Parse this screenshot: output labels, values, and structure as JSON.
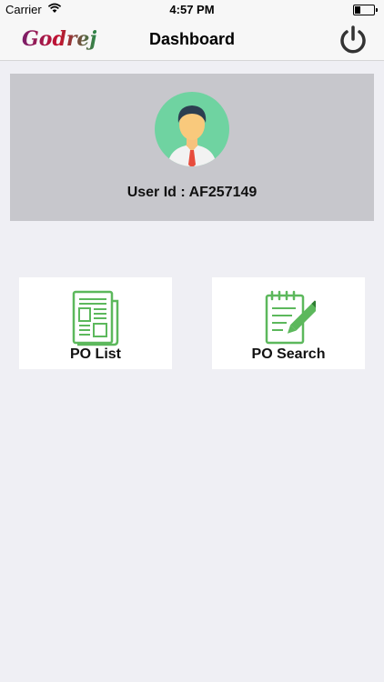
{
  "status_bar": {
    "carrier": "Carrier",
    "time": "4:57 PM",
    "wifi_icon": "wifi-icon",
    "battery_icon": "battery-icon"
  },
  "nav": {
    "logo_text": "Godrej",
    "title": "Dashboard",
    "power_icon": "power-icon"
  },
  "profile": {
    "user_label": "User Id : AF257149",
    "avatar_icon": "avatar-icon"
  },
  "tiles": [
    {
      "label": "PO List",
      "icon": "document-list-icon"
    },
    {
      "label": "PO Search",
      "icon": "notepad-pencil-icon"
    }
  ],
  "colors": {
    "background": "#efeff4",
    "card": "#c7c7cc",
    "icon_green": "#5cb85c",
    "brand_red": "#b5122e"
  }
}
